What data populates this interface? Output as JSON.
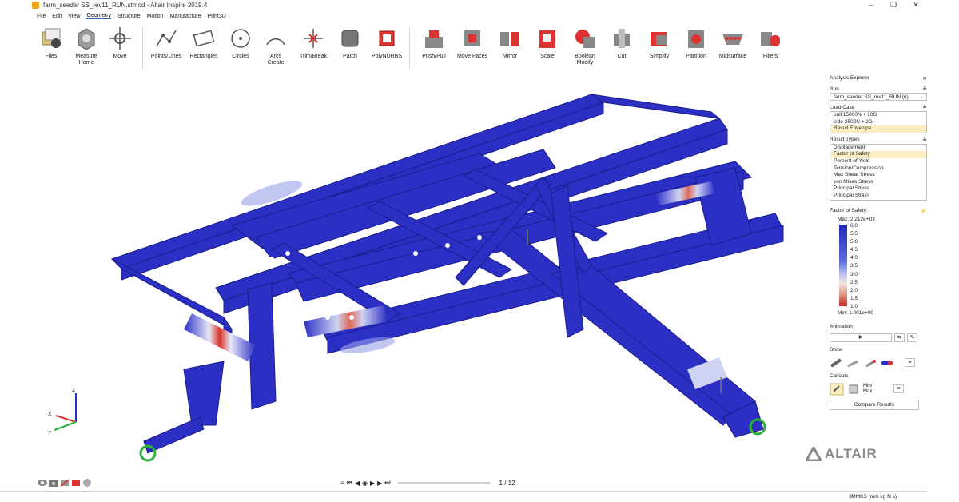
{
  "window": {
    "title": "farm_seeder SS_rev11_RUN.stmod - Altair Inspire 2019.4",
    "controls": [
      "–",
      "❐",
      "✕"
    ]
  },
  "menu": [
    "File",
    "Edit",
    "View",
    "Geometry",
    "Structure",
    "Motion",
    "Manufacture",
    "Print3D"
  ],
  "menu_active": "Geometry",
  "ribbon": {
    "files": "Files",
    "measure": "Measure",
    "measure_sub": "Home",
    "move": "Move",
    "points_lines": "Points/Lines",
    "rectangles": "Rectangles",
    "circles": "Circles",
    "arcs": "Arcs",
    "arcs_sub": "Create",
    "trim_break": "Trim/Break",
    "patch": "Patch",
    "polynurbs": "PolyNURBS",
    "push_pull": "Push/Pull",
    "move_faces": "Move Faces",
    "mirror": "Mirror",
    "scale": "Scale",
    "boolean": "Boolean",
    "boolean_sub": "Modify",
    "cut": "Cut",
    "simplify": "Simplify",
    "partition": "Partition",
    "midsurface": "Midsurface",
    "fillets": "Fillets"
  },
  "panel": {
    "title": "Analysis Explorer",
    "run_label": "Run",
    "run_value": "farm_seeder SS_rev11_RUN (6)",
    "load_case_label": "Load Case",
    "load_cases": [
      "pull 15000N + 10G",
      "side 2500N + 2G",
      "Result Envelope"
    ],
    "load_case_selected": 2,
    "result_types_label": "Result Types",
    "result_types": [
      "Displacement",
      "Factor of Safety",
      "Percent of Yield",
      "Tension/Compression",
      "Max Shear Stress",
      "von Mises Stress",
      "Principal Stress",
      "Principal Strain"
    ],
    "result_type_selected": 1,
    "legend_title": "Factor of Safety:",
    "legend_max": "Max:   2.212e+03",
    "legend_min": "Min:   1.001e+00",
    "legend_ticks": [
      "6.0",
      "5.5",
      "5.0",
      "4.5",
      "4.0",
      "3.5",
      "3.0",
      "2.5",
      "2.0",
      "1.5",
      "1.0"
    ],
    "animation_label": "Animation",
    "show_label": "Show",
    "callouts_label": "Callouts",
    "minmax_label": "Min/\nMax",
    "compare_button": "Compare Results"
  },
  "playback": {
    "frame": "1 / 12"
  },
  "status": {
    "units": "MMKS (mm kg N s)"
  },
  "brand": "ALTAIR",
  "axes": {
    "x": "X",
    "y": "Y",
    "z": "Z"
  },
  "colors": {
    "structure_blue": "#2b2fc4",
    "stress_red": "#d8362a",
    "accent": "#2a6cc7",
    "selection": "#fbeec2"
  }
}
